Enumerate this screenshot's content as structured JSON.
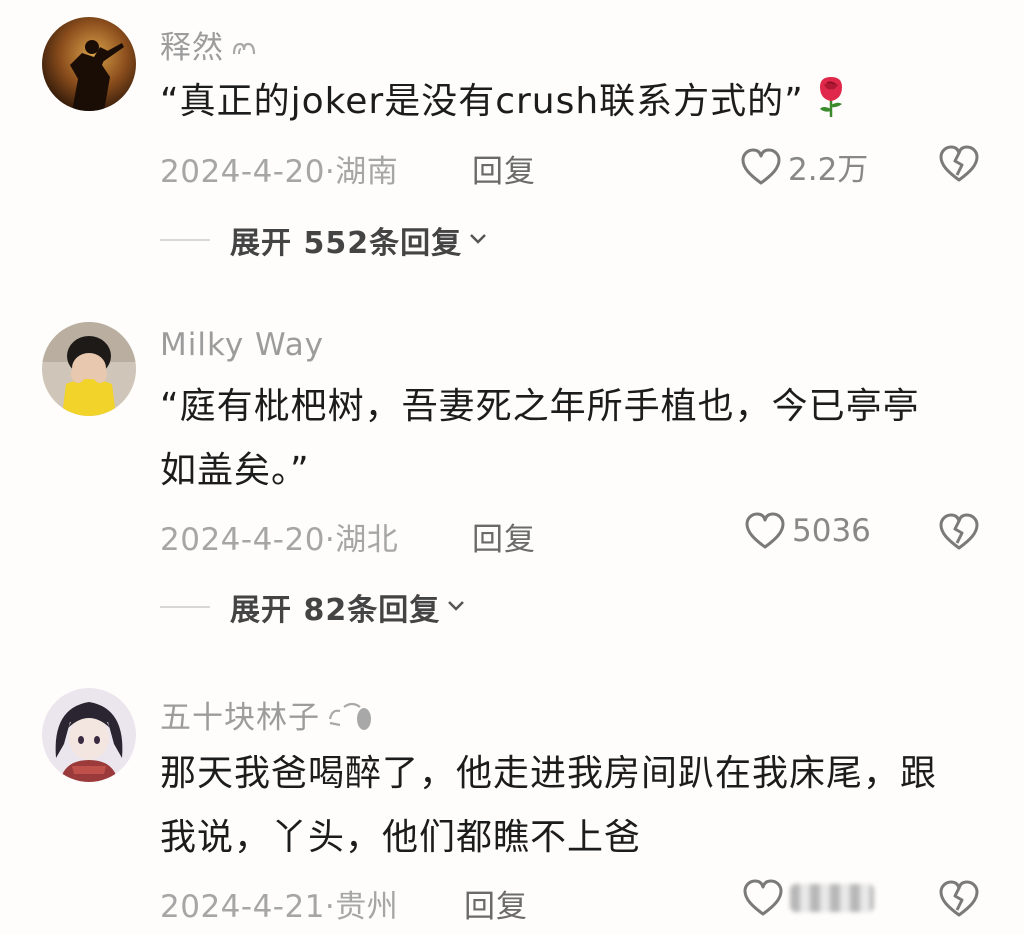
{
  "comments": [
    {
      "username": "释然",
      "text": "“真正的joker是没有crush联系方式的”",
      "emoji": "rose-emoji",
      "date_location": "2024-4-20·湖南",
      "reply_label": "回复",
      "likes": "2.2万",
      "expand_label": "展开 552条回复"
    },
    {
      "username": "Milky Way",
      "text_line1": "“庭有枇杷树，吾妻死之年所手植也，今已亭亭",
      "text_line2": "如盖矣。”",
      "date_location": "2024-4-20·湖北",
      "reply_label": "回复",
      "likes": "5036",
      "expand_label": "展开 82条回复"
    },
    {
      "username": "五十块林子",
      "text_line1": "那天我爸喝醉了，他走进我房间趴在我床尾，跟",
      "text_line2": "我说，丫头，他们都瞧不上爸",
      "date_location": "2024-4-21·贵州",
      "reply_label": "回复",
      "likes": ""
    }
  ],
  "colors": {
    "background": "#fefdfb",
    "username": "#9c9c9c",
    "text": "#1c1c1c",
    "meta": "#a6a6a6",
    "icon": "#7a7a7a"
  }
}
